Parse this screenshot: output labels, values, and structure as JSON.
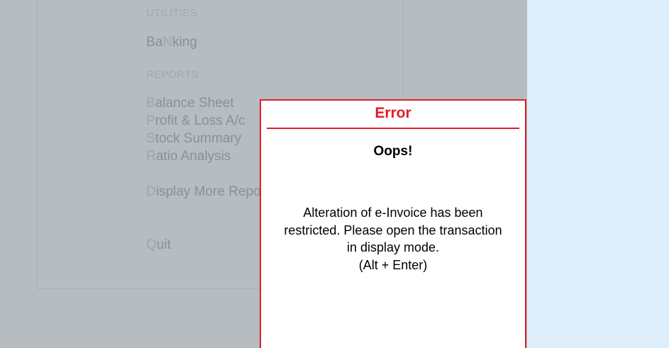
{
  "menu": {
    "utilities_header": "UTILITIES",
    "banking": {
      "pre": "Ba",
      "key": "N",
      "post": "king"
    },
    "reports_header": "REPORTS",
    "balance_sheet": {
      "key": "B",
      "rest": "alance Sheet"
    },
    "profit_loss": {
      "key": "P",
      "rest": "rofit & Loss A/c"
    },
    "stock_summary": {
      "key": "S",
      "rest": "tock Summary"
    },
    "ratio_analysis": {
      "key": "R",
      "rest": "atio Analysis"
    },
    "display_more": {
      "key": "D",
      "rest": "isplay More Reports"
    },
    "quit": {
      "key": "Q",
      "rest": "uit"
    }
  },
  "dialog": {
    "title": "Error",
    "heading": "Oops!",
    "message_lines": [
      "Alteration of e-Invoice has been",
      "restricted. Please open the transaction",
      "in display mode.",
      "(Alt + Enter)"
    ]
  },
  "colors": {
    "error_red": "#e21e26",
    "overlay_gray": "#b6bcc0",
    "right_pane": "#ddeefa"
  }
}
